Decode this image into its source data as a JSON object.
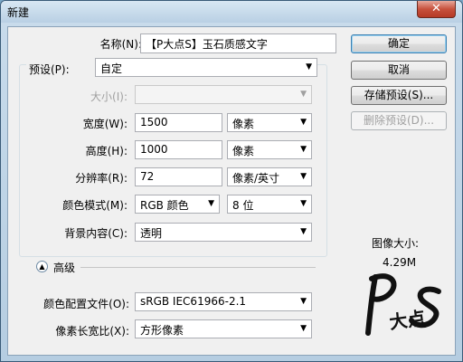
{
  "window": {
    "title": "新建",
    "close_glyph": "✕"
  },
  "fields": {
    "name": {
      "label": "名称(N):",
      "value": "【P大点S】玉石质感文字"
    },
    "preset": {
      "label": "预设(P):",
      "value": "自定"
    },
    "size": {
      "label": "大小(I):",
      "value": ""
    },
    "width": {
      "label": "宽度(W):",
      "value": "1500",
      "unit": "像素"
    },
    "height": {
      "label": "高度(H):",
      "value": "1000",
      "unit": "像素"
    },
    "resolution": {
      "label": "分辨率(R):",
      "value": "72",
      "unit": "像素/英寸"
    },
    "color_mode": {
      "label": "颜色模式(M):",
      "value": "RGB 颜色",
      "depth": "8 位"
    },
    "background": {
      "label": "背景内容(C):",
      "value": "透明"
    },
    "advanced": {
      "label": "高级",
      "icon": "chevron-up-circle-icon"
    },
    "color_profile": {
      "label": "颜色配置文件(O):",
      "value": "sRGB IEC61966-2.1"
    },
    "pixel_aspect": {
      "label": "像素长宽比(X):",
      "value": "方形像素"
    }
  },
  "buttons": {
    "ok": "确定",
    "cancel": "取消",
    "save_preset": "存储预设(S)...",
    "delete_preset": "删除预设(D)..."
  },
  "image_size": {
    "label": "图像大小:",
    "value": "4.29M"
  },
  "watermark": {
    "text": "PS 大点"
  },
  "colors": {
    "title_bar": "#c4d9ea",
    "client_bg": "#f0f0f0",
    "default_button_border": "#3c7fb1"
  }
}
